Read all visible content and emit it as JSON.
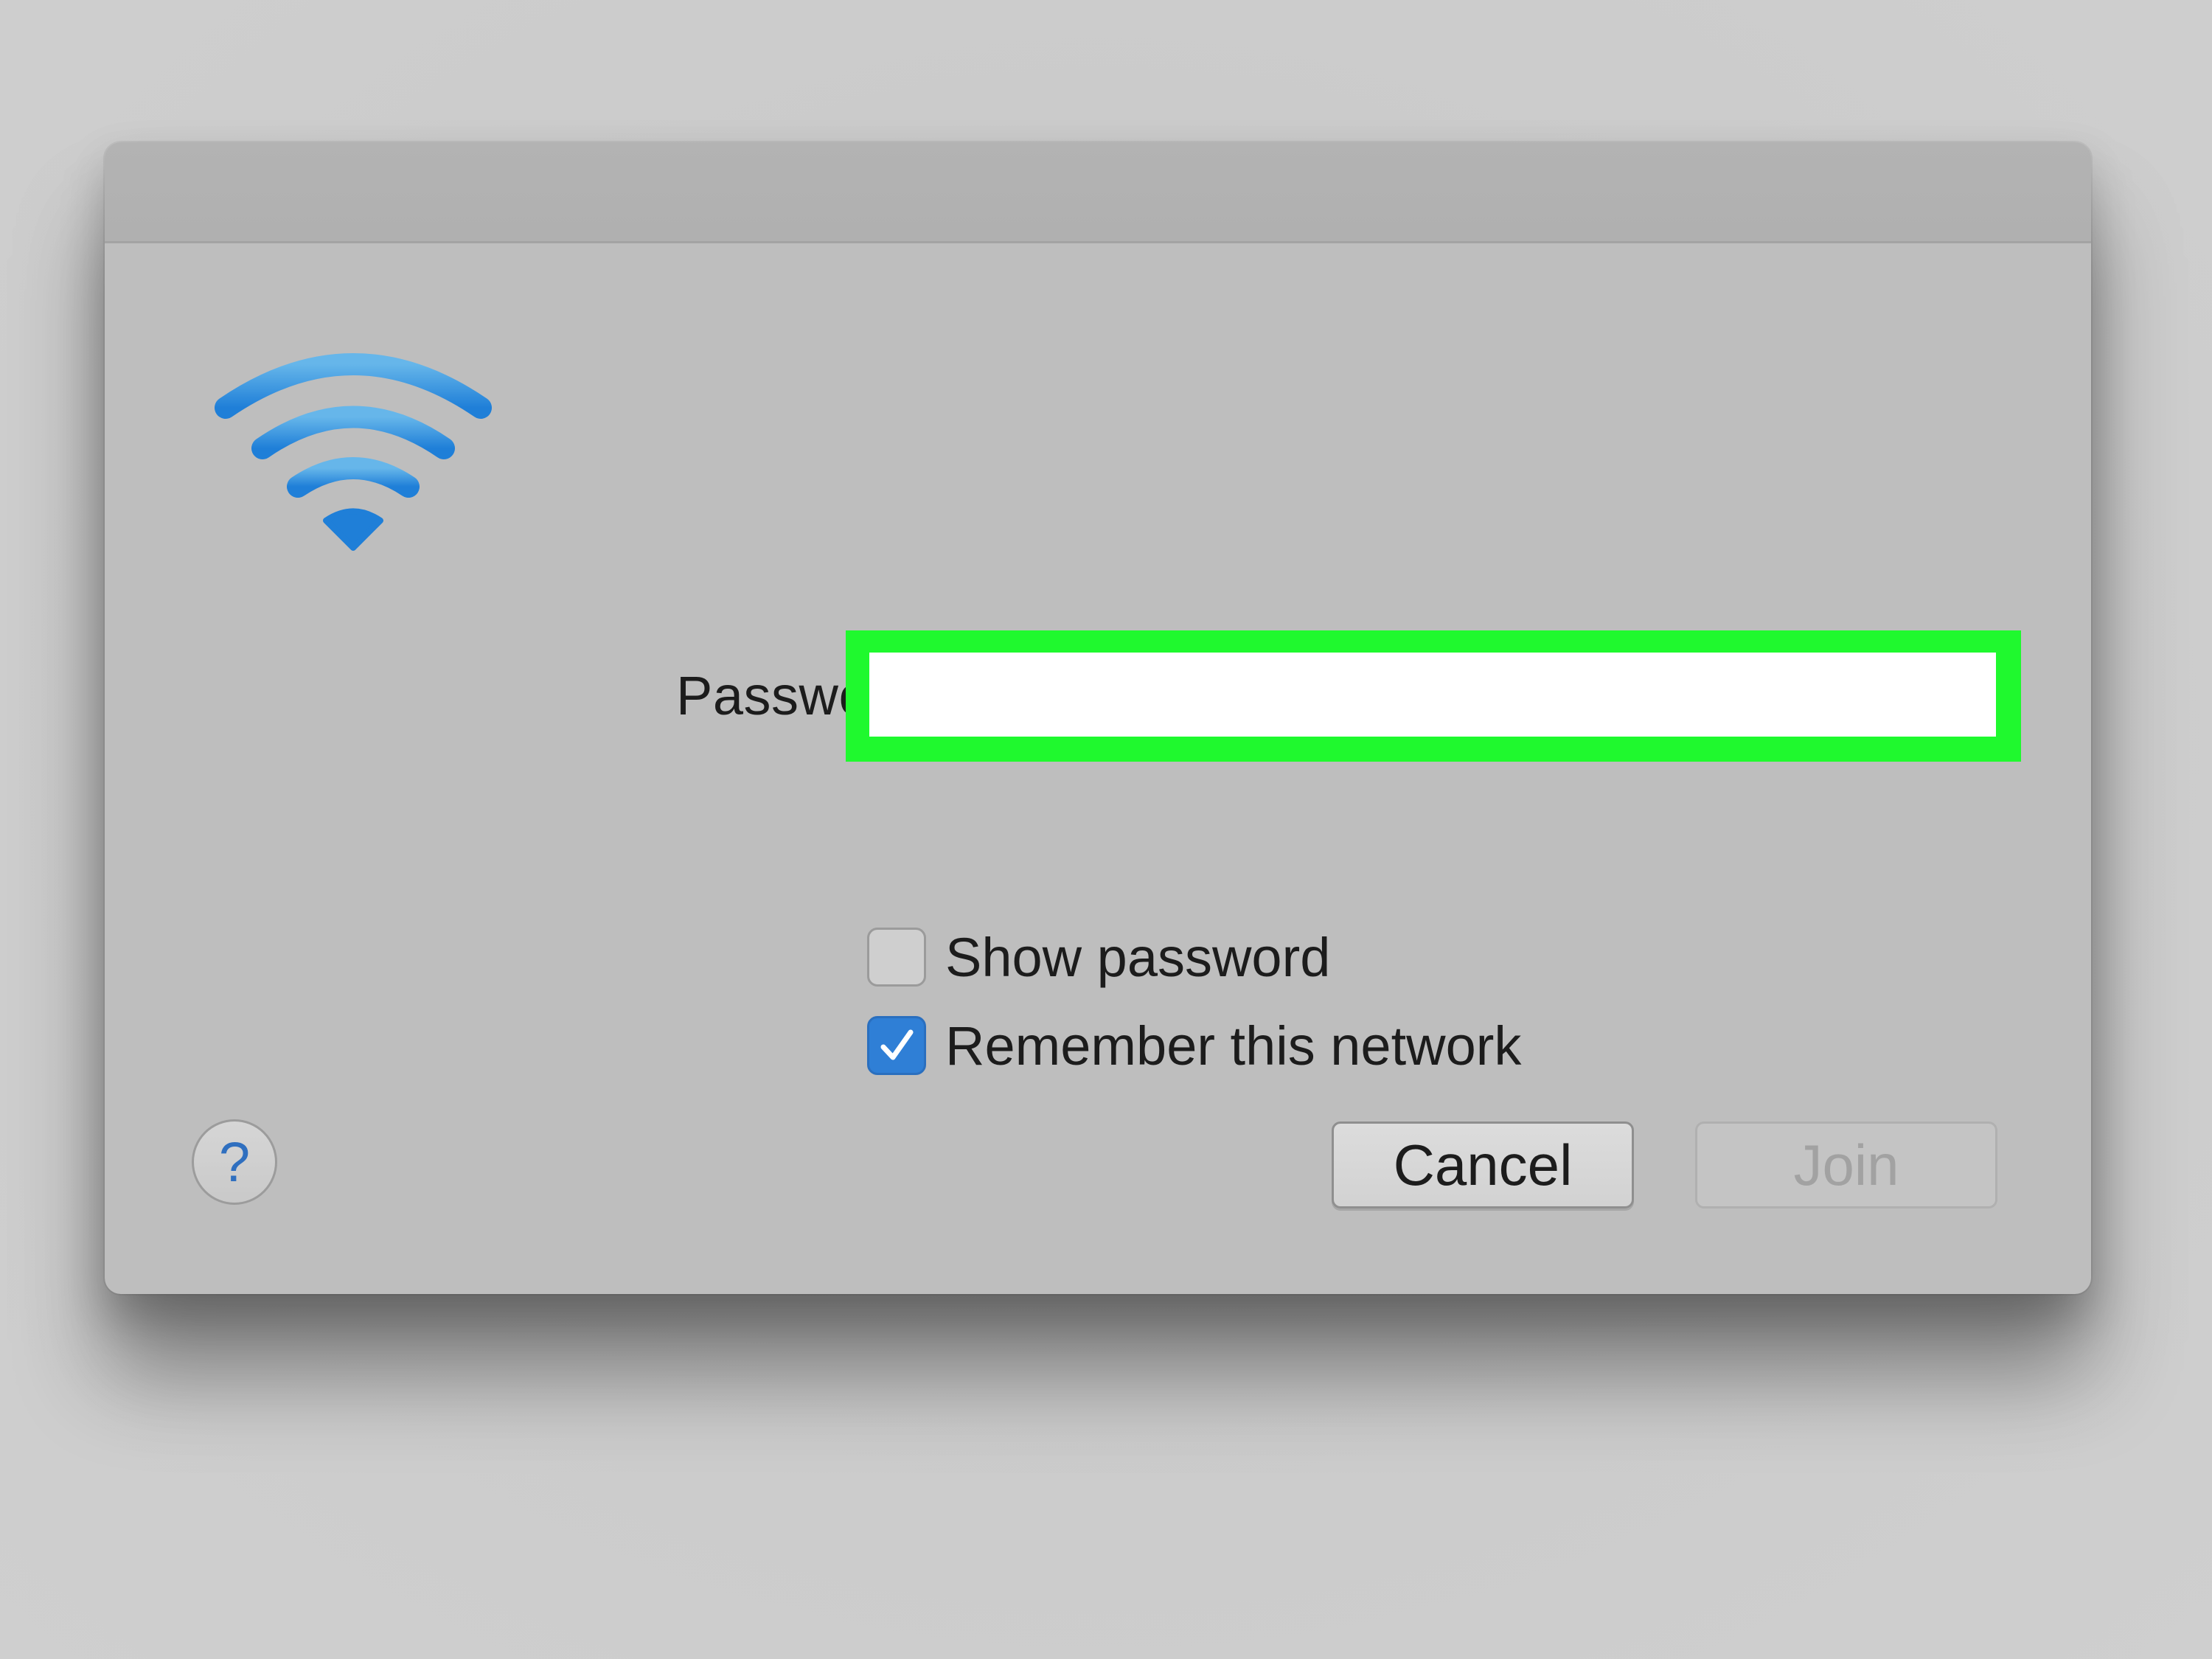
{
  "dialog": {
    "password_label": "Password:",
    "password_value": "",
    "show_password": {
      "label": "Show password",
      "checked": false
    },
    "remember_network": {
      "label": "Remember this network",
      "checked": true
    },
    "help_label": "?",
    "cancel_label": "Cancel",
    "join_label": "Join"
  },
  "colors": {
    "accent": "#2f7fd6",
    "highlight": "#1ff92e",
    "wifi": "#4aa0e0"
  },
  "icons": {
    "wifi": "wifi-icon",
    "checkmark": "checkmark-icon"
  }
}
